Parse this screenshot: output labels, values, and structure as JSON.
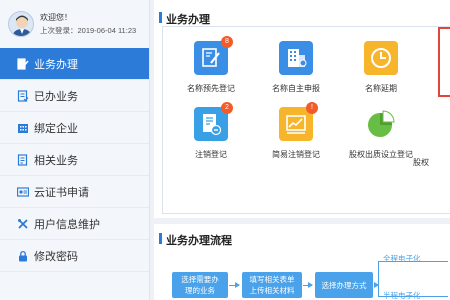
{
  "user": {
    "welcome": "欢迎您！",
    "last_login": "上次登录：2019-06-04 11:23"
  },
  "sidebar": {
    "items": [
      {
        "label": "业务办理",
        "icon": "edit-doc-icon",
        "active": true
      },
      {
        "label": "已办业务",
        "icon": "done-doc-icon",
        "active": false
      },
      {
        "label": "绑定企业",
        "icon": "building-icon",
        "active": false
      },
      {
        "label": "相关业务",
        "icon": "related-doc-icon",
        "active": false
      },
      {
        "label": "云证书申请",
        "icon": "certificate-icon",
        "active": false
      },
      {
        "label": "用户信息维护",
        "icon": "tools-icon",
        "active": false
      },
      {
        "label": "修改密码",
        "icon": "lock-icon",
        "active": false
      }
    ]
  },
  "business": {
    "title": "业务办理",
    "tiles": [
      {
        "label": "名称预先登记",
        "icon": "pen-doc-icon",
        "color": "#3a8ee6",
        "badge": "8"
      },
      {
        "label": "名称自主申报",
        "icon": "building-icon",
        "color": "#3a8ee6",
        "badge": ""
      },
      {
        "label": "名称延期",
        "icon": "clock-icon",
        "color": "#f7b52c",
        "badge": ""
      },
      {
        "label": "注销登记",
        "icon": "cancel-doc-icon",
        "color": "#3aa0e6",
        "badge": "2"
      },
      {
        "label": "简易注销登记",
        "icon": "chart-doc-icon",
        "color": "#f7b52c",
        "badge": "!"
      },
      {
        "label": "股权出质设立登记",
        "icon": "pie-chart-icon",
        "color": "#68bd45",
        "badge": ""
      },
      {
        "label": "股权",
        "icon": "",
        "color": "",
        "badge": ""
      }
    ]
  },
  "flow": {
    "title": "业务办理流程",
    "steps": [
      "选择需要办理的业务",
      "填写相关表单上传相关材料",
      "选择办理方式"
    ],
    "steps_lines": [
      [
        "选择需要办",
        "理的业务"
      ],
      [
        "填写相关表单",
        "上传相关材料"
      ],
      [
        "选择办理方式"
      ]
    ],
    "branch_top": "全程电子化",
    "branch_bottom": "半程电子化"
  },
  "colors": {
    "accent": "#2c7bd8",
    "flow": "#4aa2ea",
    "highlight": "#e2453a",
    "badge": "#f25b2a"
  }
}
